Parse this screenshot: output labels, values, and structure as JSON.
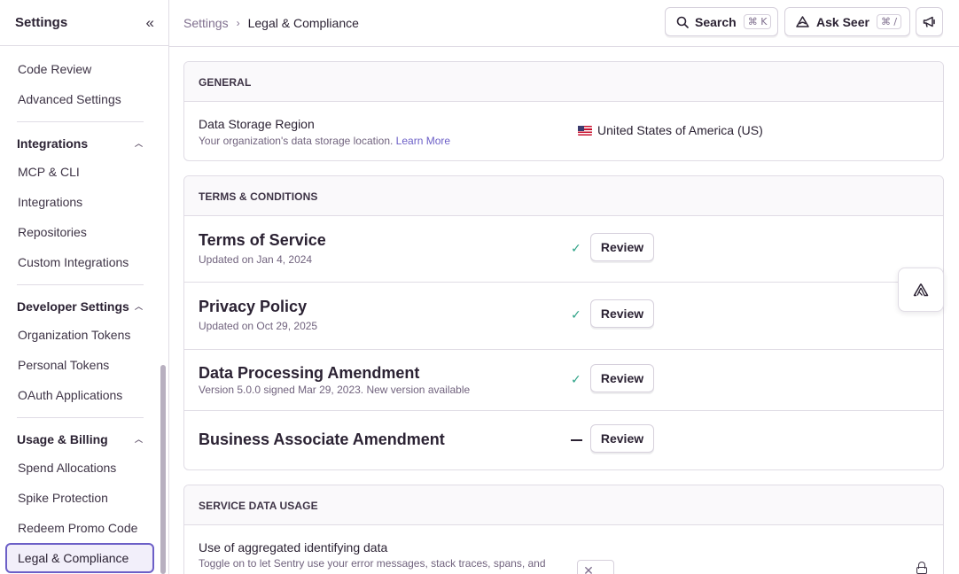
{
  "sidebar": {
    "title": "Settings",
    "items_top": [
      {
        "label": "Code Review"
      },
      {
        "label": "Advanced Settings"
      }
    ],
    "sections": [
      {
        "title": "Integrations",
        "items": [
          {
            "label": "MCP & CLI"
          },
          {
            "label": "Integrations"
          },
          {
            "label": "Repositories"
          },
          {
            "label": "Custom Integrations"
          }
        ]
      },
      {
        "title": "Developer Settings",
        "items": [
          {
            "label": "Organization Tokens"
          },
          {
            "label": "Personal Tokens"
          },
          {
            "label": "OAuth Applications"
          }
        ]
      },
      {
        "title": "Usage & Billing",
        "items": [
          {
            "label": "Spend Allocations"
          },
          {
            "label": "Spike Protection"
          },
          {
            "label": "Redeem Promo Code"
          },
          {
            "label": "Legal & Compliance"
          }
        ]
      }
    ]
  },
  "topbar": {
    "breadcrumb": {
      "root": "Settings",
      "current": "Legal & Compliance"
    },
    "search_label": "Search",
    "search_shortcut": "⌘ K",
    "ask_label": "Ask Seer",
    "ask_shortcut": "⌘ /"
  },
  "general": {
    "header": "GENERAL",
    "storage_title": "Data Storage Region",
    "storage_desc": "Your organization's data storage location.",
    "learn_more": "Learn More",
    "storage_value": "United States of America (US)"
  },
  "terms": {
    "header": "TERMS & CONDITIONS",
    "rows": [
      {
        "title": "Terms of Service",
        "desc": "Updated on Jan 4, 2024",
        "status": "✓",
        "button": "Review"
      },
      {
        "title": "Privacy Policy",
        "desc": "Updated on Oct 29, 2025",
        "status": "✓",
        "button": "Review"
      },
      {
        "title": "Data Processing Amendment",
        "desc": "Version 5.0.0 signed Mar 29, 2023. New version available",
        "status": "✓",
        "button": "Review"
      },
      {
        "title": "Business Associate Amendment",
        "desc": "",
        "status": "—",
        "button": "Review"
      }
    ]
  },
  "service": {
    "header": "SERVICE DATA USAGE",
    "row_title": "Use of aggregated identifying data",
    "row_desc": "Toggle on to let Sentry use your error messages, stack traces, spans, and",
    "toggle_symbol": "✕"
  },
  "colors": {
    "accent": "#6c5fc7",
    "check": "#2ba185"
  }
}
